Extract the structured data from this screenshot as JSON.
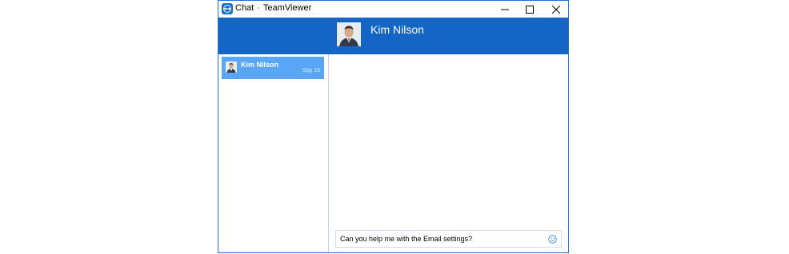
{
  "window": {
    "title_app": "Chat",
    "title_separator": "-",
    "title_product": "TeamViewer"
  },
  "header": {
    "contact_name": "Kim Nilson"
  },
  "sidebar": {
    "items": [
      {
        "name": "Kim Nilson",
        "date": "Sep 15",
        "selected": true
      }
    ]
  },
  "chat": {
    "input_value": "Can you help me with the Email settings?"
  },
  "colors": {
    "accent": "#1565c7",
    "selected_item": "#58a6f5",
    "border": "#1a73d6"
  }
}
